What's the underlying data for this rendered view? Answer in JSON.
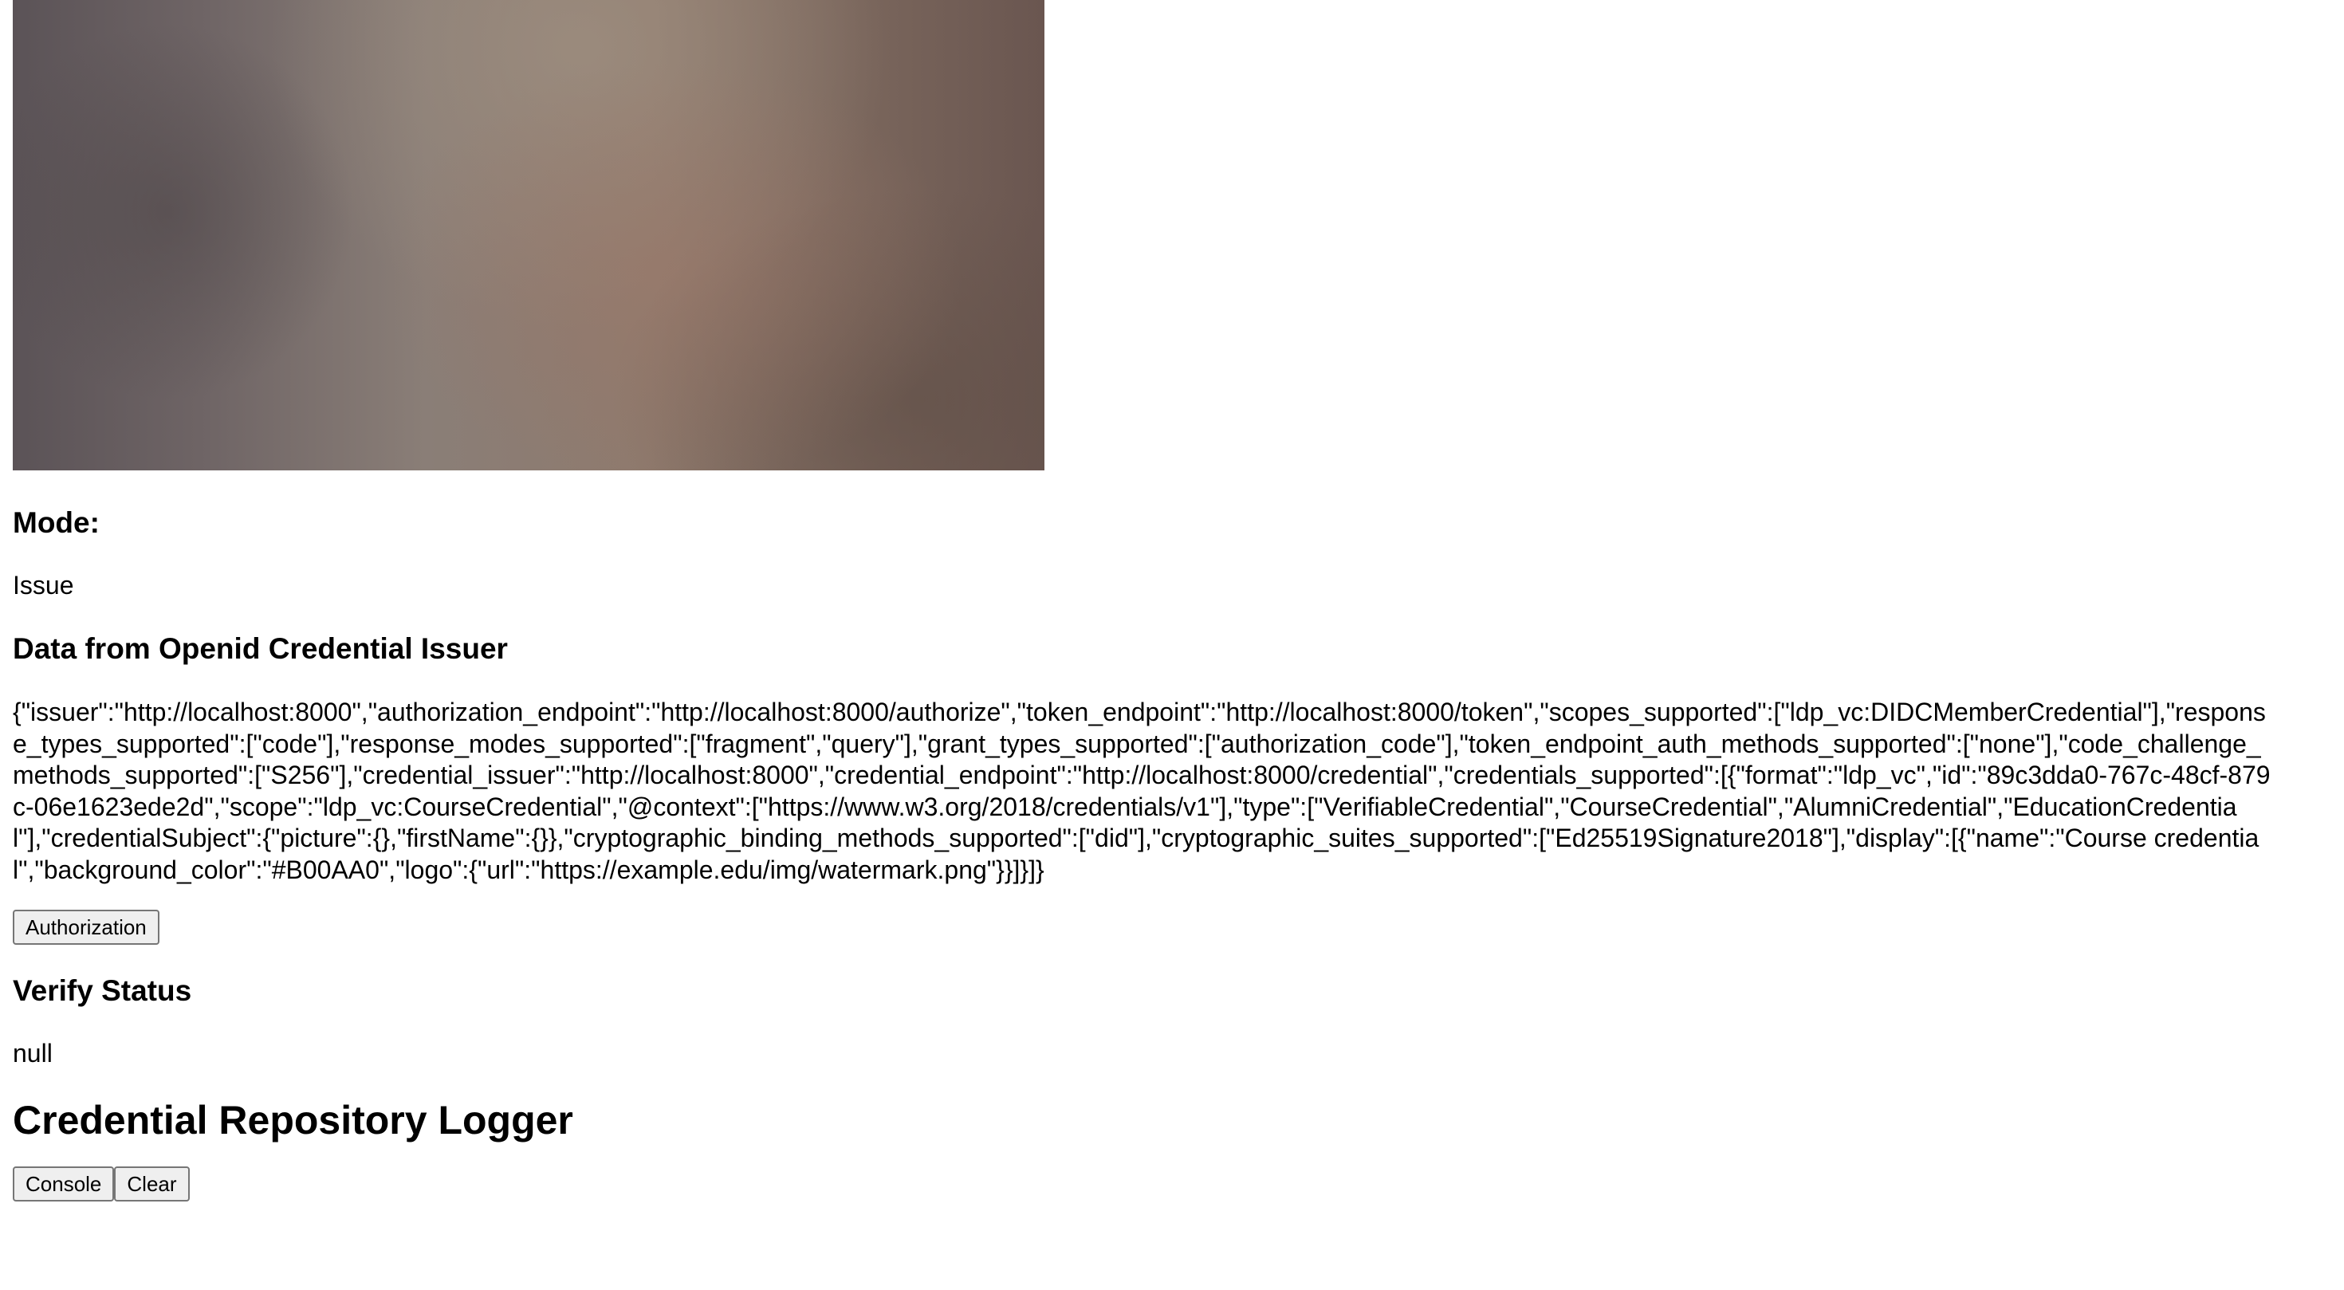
{
  "mode": {
    "heading": "Mode:",
    "value": "Issue"
  },
  "issuer_data": {
    "heading": "Data from Openid Credential Issuer",
    "json_text": "{\"issuer\":\"http://localhost:8000\",\"authorization_endpoint\":\"http://localhost:8000/authorize\",\"token_endpoint\":\"http://localhost:8000/token\",\"scopes_supported\":[\"ldp_vc:DIDCMemberCredential\"],\"response_types_supported\":[\"code\"],\"response_modes_supported\":[\"fragment\",\"query\"],\"grant_types_supported\":[\"authorization_code\"],\"token_endpoint_auth_methods_supported\":[\"none\"],\"code_challenge_methods_supported\":[\"S256\"],\"credential_issuer\":\"http://localhost:8000\",\"credential_endpoint\":\"http://localhost:8000/credential\",\"credentials_supported\":[{\"format\":\"ldp_vc\",\"id\":\"89c3dda0-767c-48cf-879c-06e1623ede2d\",\"scope\":\"ldp_vc:CourseCredential\",\"@context\":[\"https://www.w3.org/2018/credentials/v1\"],\"type\":[\"VerifiableCredential\",\"CourseCredential\",\"AlumniCredential\",\"EducationCredential\"],\"credentialSubject\":{\"picture\":{},\"firstName\":{}},\"cryptographic_binding_methods_supported\":[\"did\"],\"cryptographic_suites_supported\":[\"Ed25519Signature2018\"],\"display\":[{\"name\":\"Course credential\",\"background_color\":\"#B00AA0\",\"logo\":{\"url\":\"https://example.edu/img/watermark.png\"}}]}]}"
  },
  "authorization_button": "Authorization",
  "verify": {
    "heading": "Verify Status",
    "value": "null"
  },
  "logger": {
    "heading": "Credential Repository Logger",
    "console_button": "Console",
    "clear_button": "Clear"
  }
}
